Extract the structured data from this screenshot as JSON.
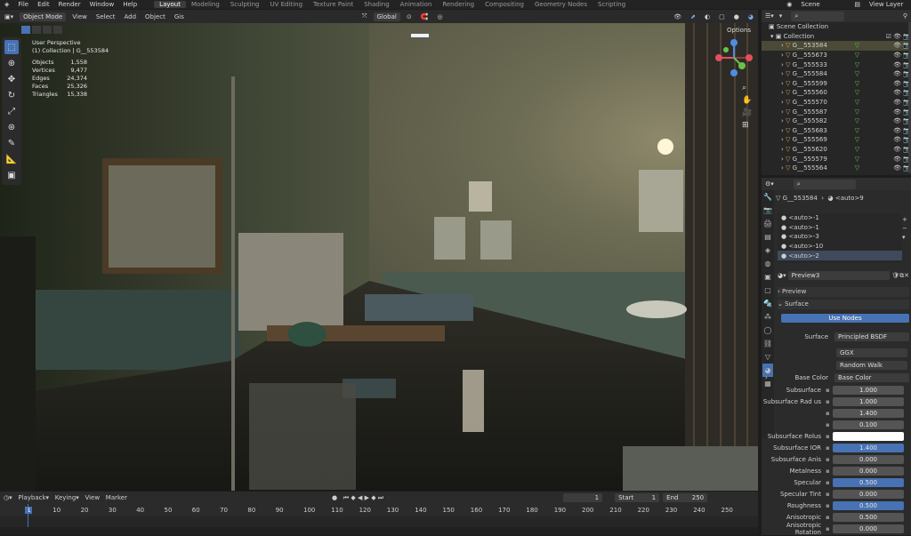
{
  "menu": {
    "items": [
      "File",
      "Edit",
      "Render",
      "Window",
      "Help"
    ]
  },
  "workspaces": [
    "Layout",
    "Modeling",
    "Sculpting",
    "UV Editing",
    "Texture Paint",
    "Shading",
    "Animation",
    "Rendering",
    "Compositing",
    "Geometry Nodes",
    "Scripting"
  ],
  "scene": "Scene",
  "view_layer": "View Layer",
  "header": {
    "mode": "Object Mode",
    "view": "View",
    "select": "Select",
    "add": "Add",
    "object": "Object",
    "gis": "Gis",
    "transform": "Global",
    "options": "Options"
  },
  "overlay_info": {
    "line1": "User Perspective",
    "line2": "(1) Collection | G__553584",
    "stats": [
      {
        "k": "Objects",
        "v": "1,558"
      },
      {
        "k": "Vertices",
        "v": "9,477"
      },
      {
        "k": "Edges",
        "v": "24,374"
      },
      {
        "k": "Faces",
        "v": "25,326"
      },
      {
        "k": "Triangles",
        "v": "15,338"
      }
    ]
  },
  "outliner": {
    "scene_collection": "Scene Collection",
    "collection": "Collection",
    "items": [
      "G__553584",
      "G__555673",
      "G__555533",
      "G__555584",
      "G__555599",
      "G__555560",
      "G__555570",
      "G__555587",
      "G__555582",
      "G__555683",
      "G__555569",
      "G__555620",
      "G__555579",
      "G__555564"
    ]
  },
  "properties": {
    "object": "G__553584",
    "material_short": "<auto>9",
    "slots": [
      "<auto>-1",
      "<auto>-1",
      "<auto>-3",
      "<auto>-10",
      "<auto>-2"
    ],
    "material": "Preview3",
    "preview": "Preview",
    "surface": "Surface",
    "use_nodes": "Use Nodes",
    "surface_label": "Surface",
    "surface_val": "Principled BSDF",
    "ggx": "GGX",
    "random_walk": "Random Walk",
    "base_color_label": "Base Color",
    "base_color_val": "Base Color",
    "fields": [
      {
        "l": "Subsurface",
        "v": "1.000"
      },
      {
        "l": "Subsurface Rad us",
        "v": "1.000"
      },
      {
        "l": "",
        "v": "1.400"
      },
      {
        "l": "",
        "v": "0.100"
      },
      {
        "l": "Subsurface Rolus",
        "v": ""
      },
      {
        "l": "Subsurface IOR",
        "v": "1.400"
      },
      {
        "l": "Subsurface Anis",
        "v": "0.000"
      },
      {
        "l": "Metalness",
        "v": "0.000"
      },
      {
        "l": "Specular",
        "v": "0.500"
      },
      {
        "l": "Specular Tint",
        "v": "0.000"
      },
      {
        "l": "Roughness",
        "v": "0.500"
      },
      {
        "l": "Anisotropic",
        "v": "0.500"
      },
      {
        "l": "Anisotropic Rotation",
        "v": "0.000"
      }
    ]
  },
  "timeline": {
    "playback": "Playback",
    "keying": "Keying",
    "view": "View",
    "marker": "Marker",
    "current": "1",
    "start_label": "Start",
    "start": "1",
    "end_label": "End",
    "end": "250",
    "ticks": [
      "1",
      "10",
      "20",
      "30",
      "40",
      "50",
      "60",
      "70",
      "80",
      "90",
      "100",
      "110",
      "120",
      "130",
      "140",
      "150",
      "160",
      "170",
      "180",
      "190",
      "200",
      "210",
      "220",
      "230",
      "240",
      "250"
    ]
  }
}
